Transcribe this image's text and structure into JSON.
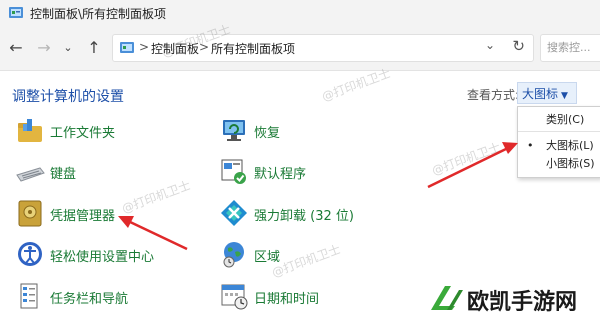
{
  "window": {
    "title": "控制面板\\所有控制面板项"
  },
  "address": {
    "crumbs": [
      "控制面板",
      "所有控制面板项"
    ],
    "separator": ">",
    "search_placeholder": "搜索控..."
  },
  "heading": "调整计算机的设置",
  "view_by": {
    "label": "查看方式:",
    "value": "大图标",
    "menu": [
      {
        "label": "类别(C)",
        "selected": false
      },
      {
        "label": "大图标(L)",
        "selected": true
      },
      {
        "label": "小图标(S)",
        "selected": false
      }
    ]
  },
  "items": {
    "left": [
      "工作文件夹",
      "键盘",
      "凭据管理器",
      "轻松使用设置中心",
      "任务栏和导航"
    ],
    "right": [
      "恢复",
      "默认程序",
      "强力卸载 (32 位)",
      "区域",
      "日期和时间"
    ]
  },
  "watermark": "@打印机卫士",
  "brand": {
    "name": "欧凯手游网"
  },
  "colors": {
    "link": "#1a7a35",
    "heading": "#1d4fa8",
    "arrow": "#e0292a",
    "window_bg": "#f3f3f3"
  }
}
